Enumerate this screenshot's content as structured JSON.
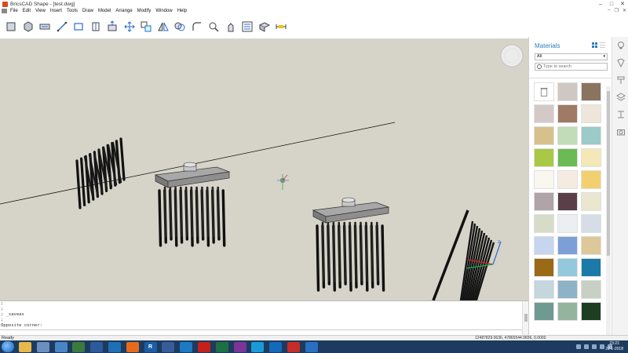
{
  "window": {
    "title": "BricsCAD Shape - [test.dwg]"
  },
  "menu": [
    "File",
    "Edit",
    "View",
    "Insert",
    "Tools",
    "Draw",
    "Model",
    "Arrange",
    "Modify",
    "Window",
    "Help"
  ],
  "toolbar_icons": [
    "box-tool-icon",
    "solid-tool-icon",
    "sweep-tool-icon",
    "line-tool-icon",
    "rectangle-tool-icon",
    "polygon-tool-icon",
    "push-pull-icon",
    "move-icon",
    "copy-icon",
    "mirror-icon",
    "rotate-icon",
    "fillet-icon",
    "zoom-icon",
    "pan-icon",
    "properties-icon",
    "render-icon",
    "dimension-icon"
  ],
  "command_line": [
    ";",
    ";",
    "; _saveas",
    ";",
    "Opposite corner:"
  ],
  "status": {
    "text": "Ready",
    "coords": "12487829.0636, 47865544.9836, 0.0000"
  },
  "taskbar_apps": [
    {
      "name": "explorer",
      "color": "#e7b84a",
      "glyph": ""
    },
    {
      "name": "paint",
      "color": "#6b8fbf",
      "glyph": ""
    },
    {
      "name": "photos",
      "color": "#4a86c5",
      "glyph": ""
    },
    {
      "name": "chart-app",
      "color": "#3b7a3f",
      "glyph": ""
    },
    {
      "name": "autodesk",
      "color": "#2d5a9a",
      "glyph": ""
    },
    {
      "name": "revit-view",
      "color": "#1f6fb5",
      "glyph": ""
    },
    {
      "name": "firefox",
      "color": "#e76a1c",
      "glyph": ""
    },
    {
      "name": "revit",
      "color": "#1a5ea8",
      "glyph": "R"
    },
    {
      "name": "viewer",
      "color": "#375c99",
      "glyph": ""
    },
    {
      "name": "navisworks",
      "color": "#1b7ac2",
      "glyph": ""
    },
    {
      "name": "acrobat",
      "color": "#c4211b",
      "glyph": ""
    },
    {
      "name": "excel",
      "color": "#1d7044",
      "glyph": ""
    },
    {
      "name": "onenote",
      "color": "#7b3597",
      "glyph": ""
    },
    {
      "name": "skype",
      "color": "#1a9bd8",
      "glyph": ""
    },
    {
      "name": "outlook",
      "color": "#1469b8",
      "glyph": ""
    },
    {
      "name": "bricscad",
      "color": "#c62d26",
      "glyph": ""
    },
    {
      "name": "bim-app",
      "color": "#2a6fc0",
      "glyph": ""
    }
  ],
  "clock": {
    "time": "23:22",
    "date": "22-1-2018"
  },
  "materials": {
    "title": "Materials",
    "filter": "All",
    "search_placeholder": "Type to search",
    "swatches": [
      "#ffffff",
      "#cfc8c2",
      "#8a7460",
      "#d5c9c5",
      "#a07a64",
      "#eee6da",
      "#d8c08c",
      "#c2dcb8",
      "#9ccac8",
      "#a8c846",
      "#6aba55",
      "#f5e8b8",
      "#faf6f0",
      "#f6ebe0",
      "#f2d070",
      "#b0a4a8",
      "#5a3f48",
      "#ebe6d0",
      "#d6dcc8",
      "#eceff2",
      "#d6dde6",
      "#c6d6ee",
      "#7ca0d6",
      "#dcc898",
      "#9a6a16",
      "#94c8dc",
      "#1a7aa8",
      "#c4d6de",
      "#8eb2c6",
      "#c8d0c6",
      "#6e9a92",
      "#94b49e",
      "#1e3e22"
    ]
  }
}
